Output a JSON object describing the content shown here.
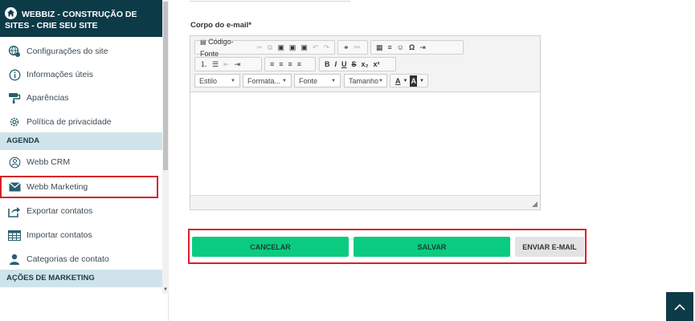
{
  "sidebar": {
    "header_title": "WEBBIZ - CONSTRUÇÃO DE SITES - CRIE SEU SITE",
    "items": [
      {
        "label": "Configurações do site",
        "icon": "globe-gear-icon"
      },
      {
        "label": "Informações úteis",
        "icon": "info-icon"
      },
      {
        "label": "Aparências",
        "icon": "paint-roller-icon"
      },
      {
        "label": "Política de privacidade",
        "icon": "cog-icon"
      }
    ],
    "section_agenda": "AGENDA",
    "agenda_items": [
      {
        "label": "Webb CRM",
        "icon": "crm-icon"
      },
      {
        "label": "Webb Marketing",
        "icon": "envelope-icon"
      },
      {
        "label": "Exportar contatos",
        "icon": "export-icon"
      },
      {
        "label": "Importar contatos",
        "icon": "table-icon"
      },
      {
        "label": "Categorias de contato",
        "icon": "user-icon"
      }
    ],
    "section_marketing": "AÇÕES DE MARKETING"
  },
  "form": {
    "body_label": "Corpo do e-mail*"
  },
  "editor": {
    "source_label": "Código-Fonte",
    "combos": {
      "style": "Estilo",
      "format": "Formata...",
      "font": "Fonte",
      "size": "Tamanho"
    },
    "format_buttons": [
      "B",
      "I",
      "U",
      "S",
      "x₂",
      "x²"
    ]
  },
  "actions": {
    "cancel": "CANCELAR",
    "save": "SALVAR",
    "send": "ENVIAR E-MAIL"
  },
  "colors": {
    "sidebar_header": "#0d3a47",
    "section_bg": "#cfe4ea",
    "accent_green": "#0bcb80",
    "highlight_red": "#d8202b"
  }
}
